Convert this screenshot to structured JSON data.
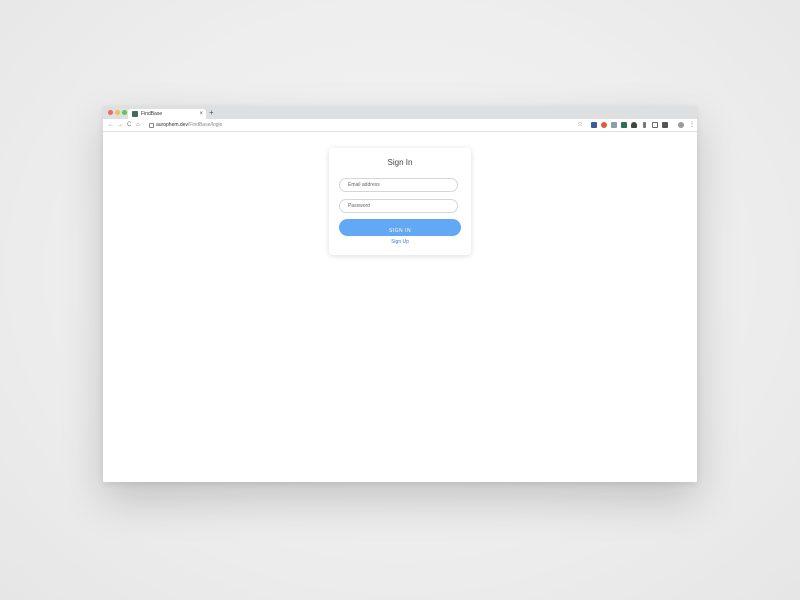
{
  "browser": {
    "tab": {
      "title": "FindBase",
      "close": "×"
    },
    "new_tab": "+",
    "nav": {
      "back": "←",
      "forward": "→",
      "reload": "C",
      "home": "⌂"
    },
    "url": {
      "host": "aurophem.dev",
      "path": "/FindBase/login"
    },
    "bookmark": "☆",
    "menu": "⋮",
    "traffic_colors": [
      "#ee6a5f",
      "#f5bd4f",
      "#61c454"
    ]
  },
  "signin": {
    "title": "Sign In",
    "email_placeholder": "Email address",
    "password_placeholder": "Password",
    "button_label": "SIGN IN",
    "signup_link": "Sign Up"
  },
  "colors": {
    "primary_button": "#62a8f5",
    "link": "#3a7bd5"
  }
}
